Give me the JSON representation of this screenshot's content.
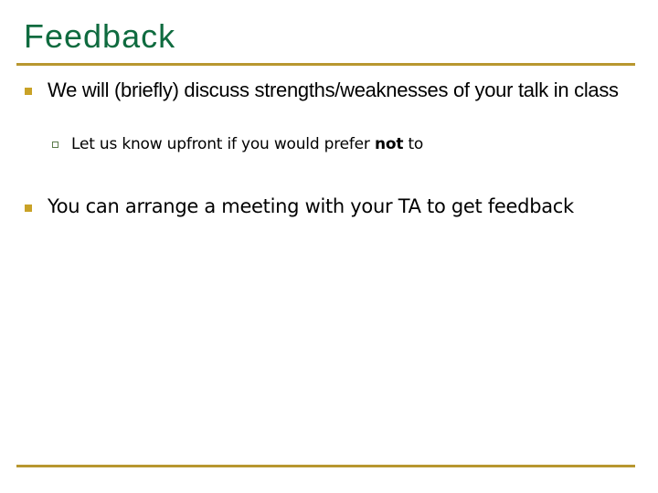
{
  "slide": {
    "title": "Feedback",
    "colors": {
      "title": "#0f6b3f",
      "rule": "#b8972f",
      "bullet": "#c9a227",
      "sub_bullet_border": "#5a7a4a"
    },
    "bullets": [
      {
        "text": "We will (briefly) discuss strengths/weaknesses of your talk in class",
        "icon": "filled-square-bullet",
        "sub_bullets": [
          {
            "text_before": "Let us know upfront if you would prefer ",
            "text_bold": "not",
            "text_after": " to",
            "icon": "hollow-square-bullet"
          }
        ]
      },
      {
        "text": "You can arrange a meeting with your TA to get feedback",
        "icon": "filled-square-bullet"
      }
    ]
  }
}
